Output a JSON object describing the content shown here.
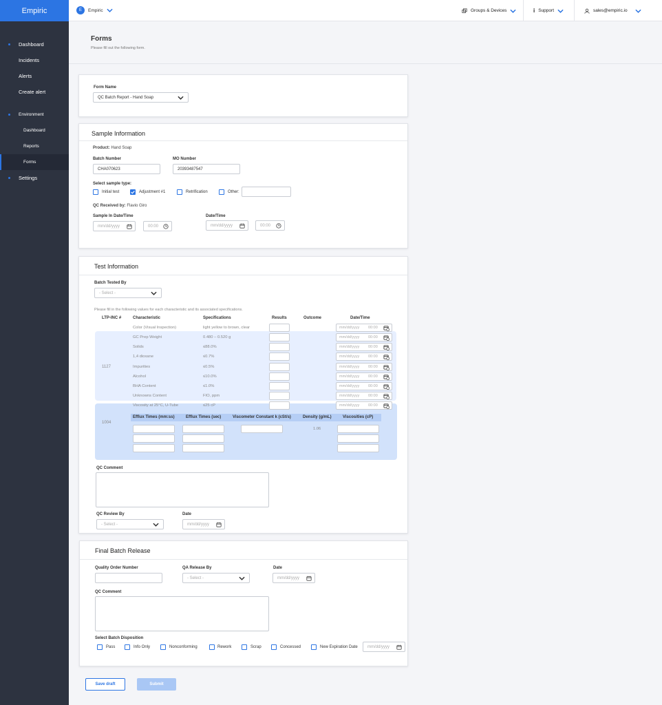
{
  "brand": "Empiric",
  "org": {
    "initial": "E",
    "name": "Empiric"
  },
  "topbar": {
    "groups": "Groups & Devices",
    "support": "Support",
    "user": "sales@empiric.io"
  },
  "sidebar": {
    "dashboard": "Dashboard",
    "incidents": "Incidents",
    "alerts": "Alerts",
    "create_alert": "Create alert",
    "environment": "Environment",
    "env_dashboard": "Dashboard",
    "reports": "Reports",
    "forms": "Forms",
    "settings": "Settings"
  },
  "page": {
    "title": "Forms",
    "subtitle": "Please fill out the following form."
  },
  "form_name": {
    "label": "Form Name",
    "value": "QC Batch Report - Hand Soap"
  },
  "sample": {
    "title": "Sample Information",
    "product_label": "Product:",
    "product": "Hand Soap",
    "batch_label": "Batch Number",
    "batch": "CHA070623",
    "mo_label": "MO Number",
    "mo": "20393487547",
    "type_label": "Select sample type:",
    "initial": "Initial test",
    "adjustment": "Adjustment #1",
    "retrification": "Retrification",
    "other": "Other:",
    "qc_label": "QC Received by:",
    "qc": "Flavio Giro",
    "sample_dt_label": "Sample In Date/Time",
    "dt_label": "Date/Time",
    "date_ph": "mm/dd/yyyy",
    "time_ph": "00:00"
  },
  "test": {
    "title": "Test Information",
    "tested_by_label": "Batch Tested By",
    "select_ph": "- Select -",
    "instructions": "Please fill in the following values for each characteristic and its associated specifications.",
    "headers": {
      "ltp": "LTP-INC #",
      "char": "Characteristic",
      "spec": "Specifications",
      "results": "Results",
      "outcome": "Outcome",
      "datetime": "Date/Time"
    },
    "rows": [
      {
        "char": "Color (Visual Inspection)",
        "spec": "light yellow to brown, clear"
      },
      {
        "char": "GC Prep Weight",
        "spec": "0.480 – 0.520 g"
      },
      {
        "char": "Solids",
        "spec": "≤88.0%"
      },
      {
        "char": "1,4 dioxane",
        "spec": "≤0.7%"
      },
      {
        "char": "Impurities",
        "spec": "≤0.5%"
      },
      {
        "char": "Alcohol",
        "spec": "≤10.0%"
      },
      {
        "char": "BHA Content",
        "spec": "≤1.0%"
      },
      {
        "char": "Unknowns Content",
        "spec": "FIO, ppm"
      },
      {
        "char": "Viscosity at 25°C, U-Tube",
        "spec": "≤25 cP"
      }
    ],
    "group1": "1127",
    "group2": "1004",
    "visc_headers": {
      "efflux1": "Efflux Times (mm:ss)",
      "efflux2": "Efflux Times (sec)",
      "k": "Viscometer Constant k (cSt/s)",
      "density": "Density (g/mL)",
      "visc": "Viscosities (cP)"
    },
    "density_value": "1.06",
    "date_ph": "mm/dd/yyyy",
    "time_ph": "00:00",
    "qc_comment": "QC Comment",
    "review_by": "QC Review By",
    "date": "Date"
  },
  "release": {
    "title": "Final Batch Release",
    "qon": "Quality Order Number",
    "qa_by": "QA Release By",
    "date": "Date",
    "select_ph": "- Select -",
    "date_ph": "mm/dd/yyyy",
    "comment": "QC Comment",
    "disposition": "Select Batch Disposition",
    "options": [
      "Pass",
      "Info Only",
      "Nonconforming",
      "Rework",
      "Scrap",
      "Concessed",
      "New Expiration Date"
    ]
  },
  "buttons": {
    "save": "Save draft",
    "submit": "Submit"
  },
  "colors": {
    "accent": "#2c75e3",
    "sidebar": "#2d3340"
  }
}
